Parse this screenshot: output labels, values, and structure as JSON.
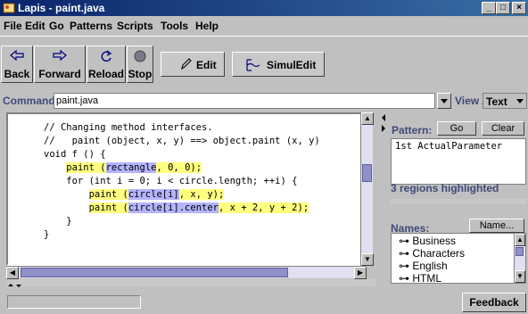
{
  "window": {
    "title": "Lapis - paint.java",
    "minimize": "_",
    "maximize": "□",
    "close": "×"
  },
  "menu": [
    "File",
    "Edit",
    "Go",
    "Patterns",
    "Scripts",
    "Tools",
    "Help"
  ],
  "toolbar": {
    "back": "Back",
    "forward": "Forward",
    "reload": "Reload",
    "stop": "Stop",
    "edit": "Edit",
    "simuledit": "SimulEdit"
  },
  "command": {
    "label": "Command:",
    "value": "paint.java"
  },
  "view_as": {
    "label": "View As:",
    "value": "Text"
  },
  "code_lines": [
    {
      "pre": "// Changing method interfaces."
    },
    {
      "pre": "//   paint (object, x, y) ==> object.paint (x, y)"
    },
    {
      "pre": "void f () {"
    },
    {
      "pre": "    ",
      "y1": "paint (",
      "b1": "rectangle",
      "y2": ", 0, 0);"
    },
    {
      "pre": "    for (int i = 0; i < circle.length; ++i) {"
    },
    {
      "pre": "        ",
      "y1": "paint (",
      "b1": "circle[i]",
      "y2": ", x, y);"
    },
    {
      "pre": "        ",
      "y1": "paint (",
      "b1": "circle[i].center",
      "y2": ", x + 2, y + 2);"
    },
    {
      "pre": "    }"
    },
    {
      "pre": "}"
    }
  ],
  "pattern": {
    "label": "Pattern:",
    "go": "Go",
    "clear": "Clear",
    "text": "1st ActualParameter"
  },
  "regions": "3 regions highlighted",
  "names": {
    "label": "Names:",
    "button": "Name...",
    "items": [
      "Business",
      "Characters",
      "English",
      "HTML"
    ]
  },
  "status": {
    "feedback": "Feedback"
  }
}
